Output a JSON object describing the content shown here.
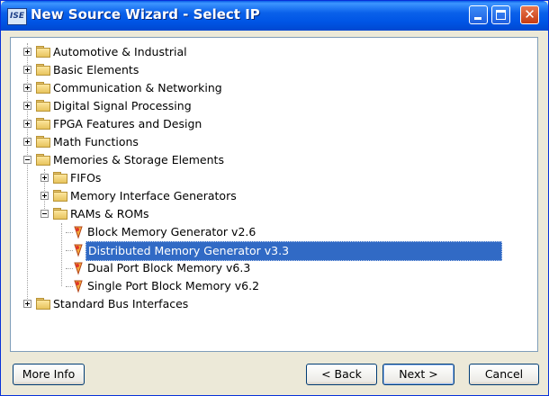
{
  "window": {
    "title": "New Source Wizard - Select IP",
    "app_icon_text": "ISE"
  },
  "tree": {
    "categories": [
      {
        "label": "Automotive & Industrial"
      },
      {
        "label": "Basic Elements"
      },
      {
        "label": "Communication & Networking"
      },
      {
        "label": "Digital Signal Processing"
      },
      {
        "label": "FPGA Features and Design"
      },
      {
        "label": "Math Functions"
      },
      {
        "label": "Memories & Storage Elements",
        "expanded": true,
        "children": [
          {
            "label": "FIFOs"
          },
          {
            "label": "Memory Interface Generators"
          },
          {
            "label": "RAMs & ROMs",
            "expanded": true,
            "children": [
              {
                "label": "Block Memory Generator v2.6"
              },
              {
                "label": "Distributed Memory Generator v3.3",
                "selected": true
              },
              {
                "label": "Dual Port Block Memory v6.3"
              },
              {
                "label": "Single Port Block Memory v6.2"
              }
            ]
          }
        ]
      },
      {
        "label": "Standard Bus Interfaces"
      }
    ]
  },
  "buttons": {
    "more_info": "More Info",
    "back": "< Back",
    "next": "Next >",
    "cancel": "Cancel"
  },
  "colors": {
    "titlebar": "#0055E5",
    "selection": "#316AC5",
    "dialog_bg": "#ECE9D8"
  }
}
